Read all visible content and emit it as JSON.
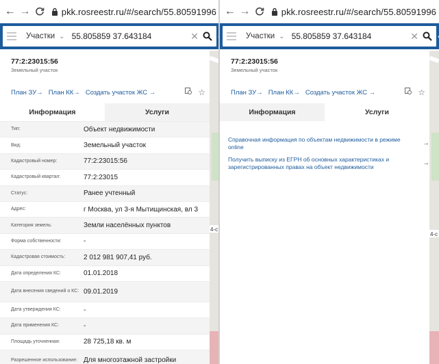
{
  "browser": {
    "back": "←",
    "forward": "→",
    "url_left": "pkk.rosreestr.ru/#/search/55.80591996",
    "url_right": "pkk.rosreestr.ru/#/search/55.80591996"
  },
  "search": {
    "type_label": "Участки",
    "value": "55.805859 37.643184"
  },
  "parcel": {
    "number": "77:2:23015:56",
    "kind": "Земельный участок"
  },
  "actions": {
    "plan_zu": "План ЗУ",
    "plan_kk": "План КК",
    "create_zhs": "Создать участок ЖС"
  },
  "tabs": {
    "info": "Информация",
    "services": "Услуги"
  },
  "info_rows": [
    {
      "key": "Тип:",
      "value": "Объект недвижимости"
    },
    {
      "key": "Вид:",
      "value": "Земельный участок"
    },
    {
      "key": "Кадастровый номер:",
      "value": "77:2:23015:56"
    },
    {
      "key": "Кадастровый квартал:",
      "value": "77:2:23015"
    },
    {
      "key": "Статус:",
      "value": "Ранее учтенный"
    },
    {
      "key": "Адрес:",
      "value": "г Москва, ул 3-я Мытищинская, вл 3"
    },
    {
      "key": "Категория земель:",
      "value": "Земли населённых пунктов"
    },
    {
      "key": "Форма собственности:",
      "value": "-"
    },
    {
      "key": "Кадастровая стоимость:",
      "value": "2 012 981 907,41 руб."
    },
    {
      "key": "Дата определения КС:",
      "value": "01.01.2018"
    },
    {
      "key": "Дата внесения сведений о КС:",
      "value": "09.01.2019"
    },
    {
      "key": "Дата утверждения КС:",
      "value": "-"
    },
    {
      "key": "Дата применения КС:",
      "value": "-"
    },
    {
      "key": "Площадь уточненная:",
      "value": "28 725,18 кв. м"
    },
    {
      "key": "Разрешенное использование:",
      "value": "Для многоэтажной застройки"
    }
  ],
  "services": [
    {
      "label": "Справочная информация по объектам недвижимости в режиме online"
    },
    {
      "label": "Получить выписку из ЕГРН об основных характеристиках и зарегистрированных правах на объект недвижимости"
    }
  ],
  "map_labels": {
    "road_label": "4-с"
  },
  "colors": {
    "header_blue": "#1d5b9c",
    "link_blue": "#1d5b9c"
  }
}
